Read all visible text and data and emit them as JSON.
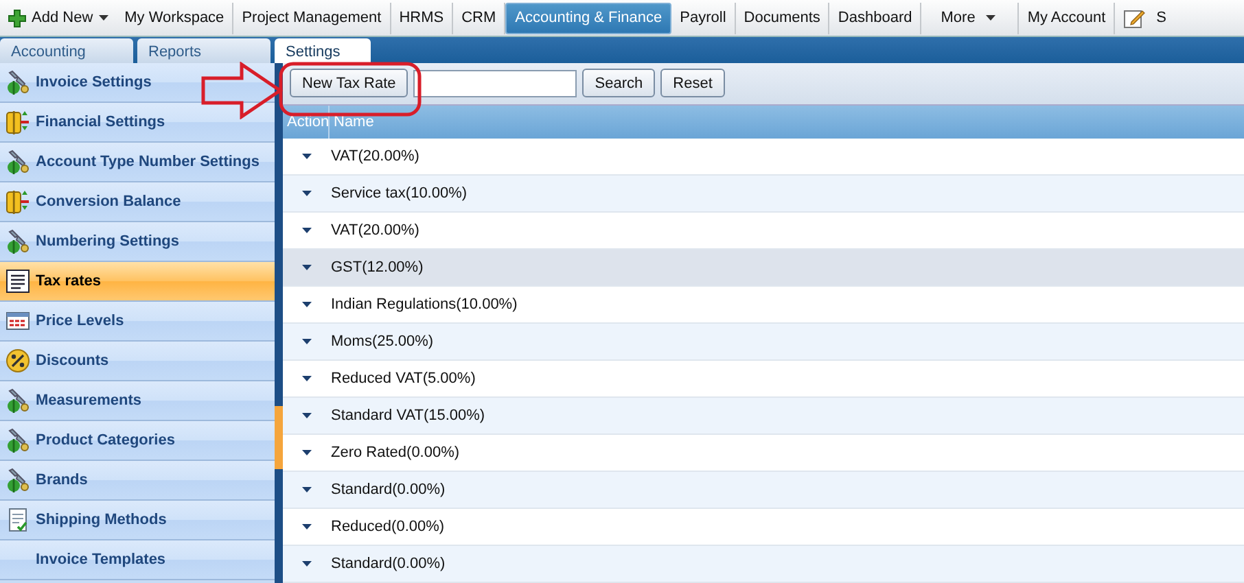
{
  "top_menu": {
    "add_new": "Add New",
    "items": [
      {
        "label": "My Workspace",
        "selected": false
      },
      {
        "label": "Project Management",
        "selected": false
      },
      {
        "label": "HRMS",
        "selected": false
      },
      {
        "label": "CRM",
        "selected": false
      },
      {
        "label": "Accounting & Finance",
        "selected": true
      },
      {
        "label": "Payroll",
        "selected": false
      },
      {
        "label": "Documents",
        "selected": false
      },
      {
        "label": "Dashboard",
        "selected": false
      }
    ],
    "more": "More",
    "account": "My Account",
    "cut_item": "S"
  },
  "tabs": [
    {
      "label": "Accounting",
      "selected": false
    },
    {
      "label": "Reports",
      "selected": false
    },
    {
      "label": "Settings",
      "selected": true
    }
  ],
  "sidebar": {
    "items": [
      {
        "label": "Invoice Settings",
        "kind": "wrench",
        "selected": false
      },
      {
        "label": "Financial Settings",
        "kind": "transfer",
        "selected": false
      },
      {
        "label": "Account Type Number Settings",
        "kind": "wrench",
        "selected": false
      },
      {
        "label": "Conversion Balance",
        "kind": "transfer",
        "selected": false
      },
      {
        "label": "Numbering Settings",
        "kind": "wrench",
        "selected": false
      },
      {
        "label": "Tax rates",
        "kind": "list",
        "selected": true
      },
      {
        "label": "Price Levels",
        "kind": "price",
        "selected": false
      },
      {
        "label": "Discounts",
        "kind": "discount",
        "selected": false
      },
      {
        "label": "Measurements",
        "kind": "wrench",
        "selected": false
      },
      {
        "label": "Product Categories",
        "kind": "wrench",
        "selected": false
      },
      {
        "label": "Brands",
        "kind": "wrench",
        "selected": false
      },
      {
        "label": "Shipping Methods",
        "kind": "document",
        "selected": false
      },
      {
        "label": "Invoice Templates",
        "kind": "none",
        "selected": false
      }
    ]
  },
  "toolbar": {
    "new_button": "New Tax Rate",
    "search_button": "Search",
    "reset_button": "Reset"
  },
  "table": {
    "columns": [
      "Action",
      "Name"
    ],
    "rows": [
      {
        "name": "VAT(20.00%)",
        "selected": false
      },
      {
        "name": "Service tax(10.00%)",
        "selected": false
      },
      {
        "name": "VAT(20.00%)",
        "selected": false
      },
      {
        "name": "GST(12.00%)",
        "selected": true
      },
      {
        "name": "Indian Regulations(10.00%)",
        "selected": false
      },
      {
        "name": "Moms(25.00%)",
        "selected": false
      },
      {
        "name": "Reduced VAT(5.00%)",
        "selected": false
      },
      {
        "name": "Standard VAT(15.00%)",
        "selected": false
      },
      {
        "name": "Zero Rated(0.00%)",
        "selected": false
      },
      {
        "name": "Standard(0.00%)",
        "selected": false
      },
      {
        "name": "Reduced(0.00%)",
        "selected": false
      },
      {
        "name": "Standard(0.00%)",
        "selected": false
      }
    ]
  }
}
